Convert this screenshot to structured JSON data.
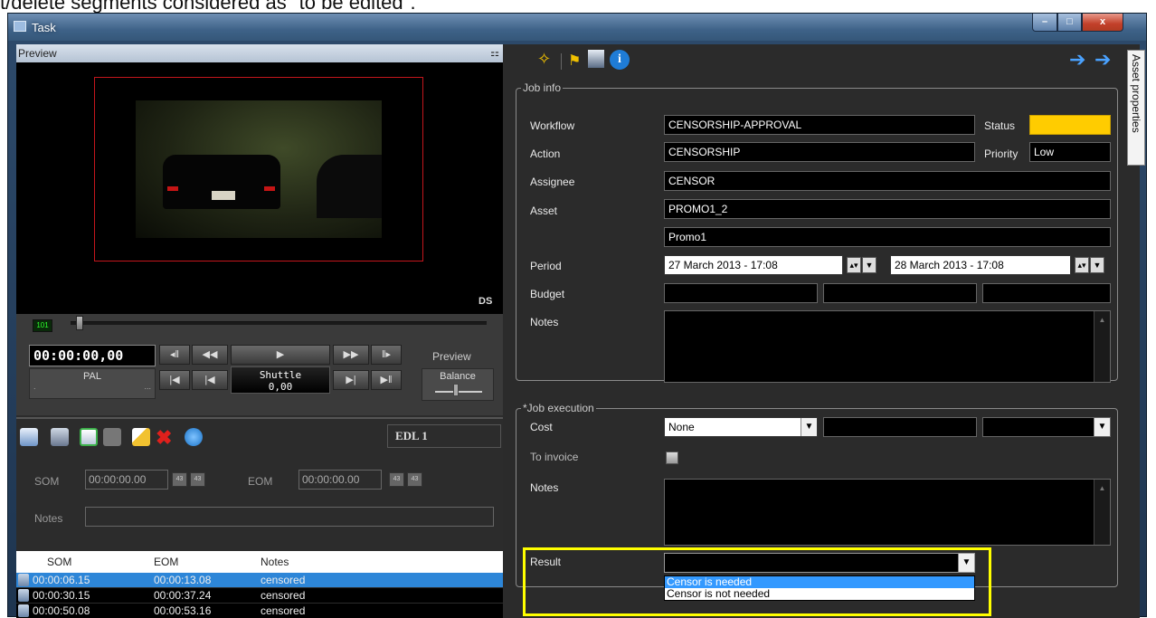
{
  "caption": "t/delete segments considered as \"to be edited\".",
  "window": {
    "title": "Task",
    "min": "–",
    "max": "□",
    "close": "x"
  },
  "preview": {
    "header": "Preview",
    "pin": "ᵖ",
    "ds": "DS",
    "led": "101",
    "timecode": "00:00:00,00",
    "pal_label": "PAL",
    "pal_sub": ".",
    "pal_dots": "...",
    "shuttle_label": "Shuttle",
    "shuttle_value": "0,00",
    "preview_label": "Preview",
    "balance_label": "Balance",
    "btn_prev_frame": "◂‖",
    "btn_rewind": "◀◀",
    "btn_play": "▶",
    "btn_ffwd": "▶▶",
    "btn_next_frame": "‖▸",
    "btn_start": "|◀",
    "btn_step_back": "|◀",
    "btn_step_fwd": "▶|",
    "btn_end": "▶‖"
  },
  "edl": {
    "name": "EDL 1",
    "som_label": "SOM",
    "som_value": "00:00:00.00",
    "eom_label": "EOM",
    "eom_value": "00:00:00.00",
    "notes_label": "Notes",
    "notes_value": "",
    "btn_a": "43",
    "btn_b": "43",
    "columns": [
      "SOM",
      "EOM",
      "Notes"
    ],
    "rows": [
      {
        "som": "00:00:06.15",
        "eom": "00:00:13.08",
        "notes": "censored",
        "selected": true
      },
      {
        "som": "00:00:30.15",
        "eom": "00:00:37.24",
        "notes": "censored",
        "selected": false
      },
      {
        "som": "00:00:50.08",
        "eom": "00:00:53.16",
        "notes": "censored",
        "selected": false
      }
    ]
  },
  "side_tab": "Asset properties",
  "job_info": {
    "legend": "Job info",
    "workflow_label": "Workflow",
    "workflow": "CENSORSHIP-APPROVAL",
    "status_label": "Status",
    "status_color": "#ffcc00",
    "action_label": "Action",
    "action": "CENSORSHIP",
    "priority_label": "Priority",
    "priority": "Low",
    "assignee_label": "Assignee",
    "assignee": "CENSOR",
    "asset_label": "Asset",
    "asset": "PROMO1_2",
    "asset_name": "Promo1",
    "period_label": "Period",
    "period_start": "27 March 2013 - 17:08",
    "period_end": "28 March 2013 - 17:08",
    "budget_label": "Budget",
    "notes_label": "Notes"
  },
  "job_execution": {
    "legend": "*Job execution",
    "cost_label": "Cost",
    "cost_value": "None",
    "to_invoice_label": "To invoice",
    "notes_label": "Notes",
    "result_label": "Result",
    "result_value": "",
    "result_options": [
      "Censor is needed",
      "Censor is not needed"
    ],
    "highlighted_option": "Censor is needed"
  }
}
